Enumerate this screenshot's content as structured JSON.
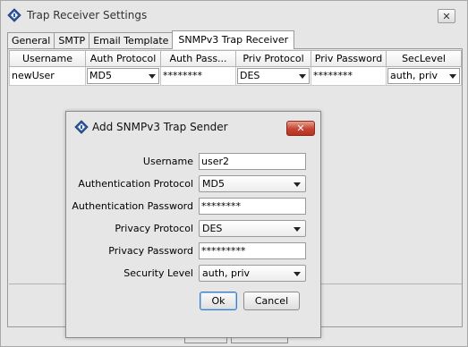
{
  "window": {
    "title": "Trap Receiver Settings",
    "close_label": "✕"
  },
  "tabs": [
    {
      "label": "General"
    },
    {
      "label": "SMTP"
    },
    {
      "label": "Email Template"
    },
    {
      "label": "SNMPv3 Trap Receiver"
    }
  ],
  "table": {
    "columns": [
      "Username",
      "Auth Protocol",
      "Auth Pass...",
      "Priv Protocol",
      "Priv Password",
      "SecLevel"
    ],
    "rows": [
      {
        "username": "newUser",
        "auth_protocol": "MD5",
        "auth_password": "********",
        "priv_protocol": "DES",
        "priv_password": "********",
        "sec_level": "auth, priv"
      }
    ]
  },
  "dialog": {
    "title": "Add SNMPv3 Trap Sender",
    "close_label": "✕",
    "fields": {
      "username": {
        "label": "Username",
        "value": "user2"
      },
      "auth_protocol": {
        "label": "Authentication Protocol",
        "value": "MD5"
      },
      "auth_password": {
        "label": "Authentication Password",
        "value": "********"
      },
      "priv_protocol": {
        "label": "Privacy Protocol",
        "value": "DES"
      },
      "priv_password": {
        "label": "Privacy Password",
        "value": "*********"
      },
      "sec_level": {
        "label": "Security Level",
        "value": "auth, priv"
      }
    },
    "ok_label": "Ok",
    "cancel_label": "Cancel"
  },
  "colors": {
    "window_bg": "#e6e6e6",
    "close_red": "#c54330",
    "default_button_border": "#3d7bc4",
    "icon_blue": "#2f5fa8"
  }
}
